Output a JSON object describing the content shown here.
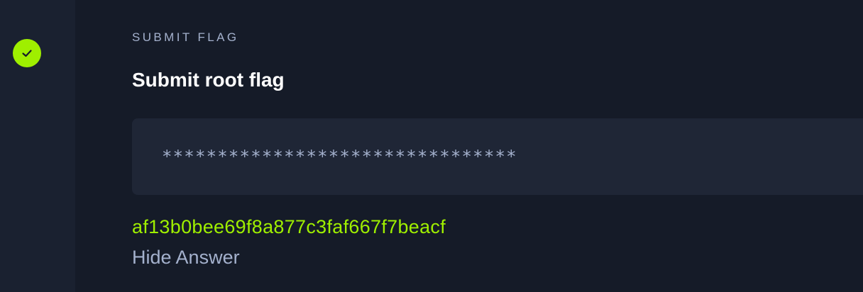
{
  "status": {
    "icon": "check-icon",
    "color": "#9fef00"
  },
  "section": {
    "label": "SUBMIT FLAG"
  },
  "question": {
    "title": "Submit root flag"
  },
  "flag_input": {
    "value": "********************************"
  },
  "answer": {
    "text": "af13b0bee69f8a877c3faf667f7beacf",
    "toggle_label": "Hide Answer"
  },
  "colors": {
    "accent": "#9fef00",
    "muted_text": "#a4b1cd",
    "panel_bg": "#151b28",
    "rail_bg": "#1a2130",
    "input_bg": "#1f2636"
  }
}
